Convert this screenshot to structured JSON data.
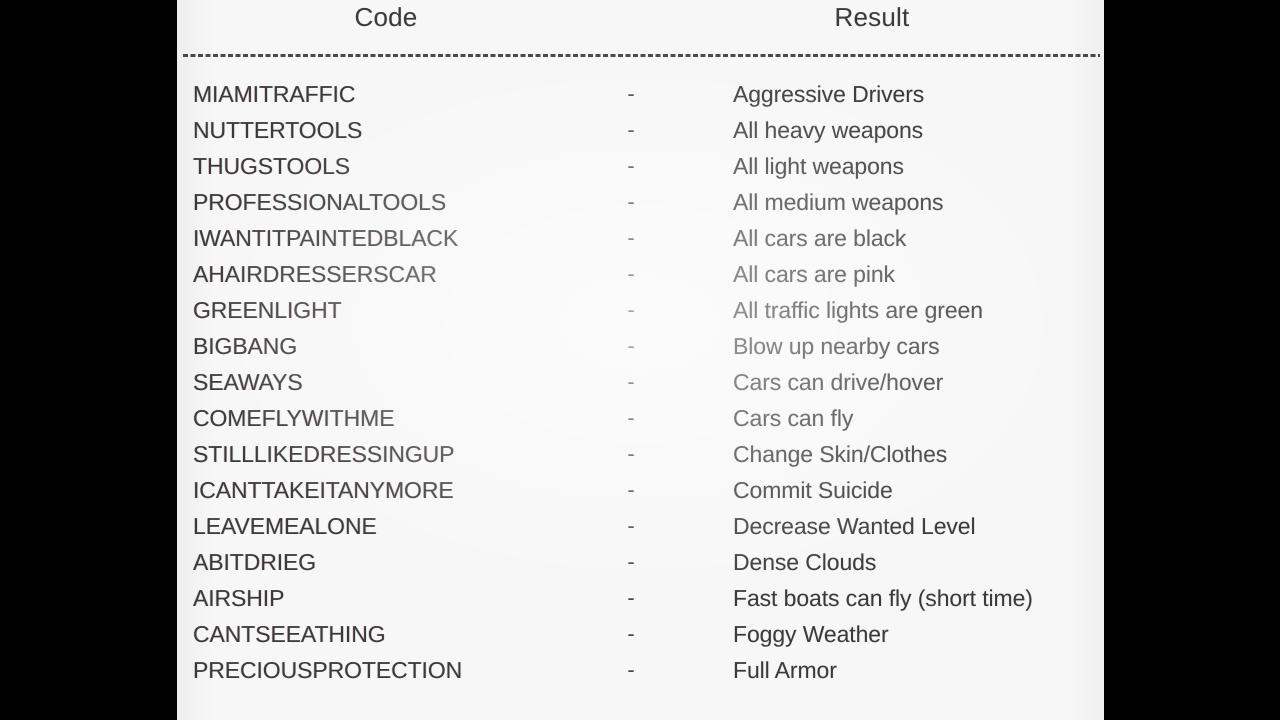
{
  "frame": {
    "letterbox_color": "#000000",
    "page_background": "#f7f7f7",
    "text_color": "#3a3a3a"
  },
  "table": {
    "headers": {
      "code": "Code",
      "result": "Result"
    },
    "separator": "-",
    "rows": [
      {
        "code": "MIAMITRAFFIC",
        "sep": "-",
        "result": "Aggressive Drivers"
      },
      {
        "code": "NUTTERTOOLS",
        "sep": "-",
        "result": "All heavy weapons"
      },
      {
        "code": "THUGSTOOLS",
        "sep": "-",
        "result": "All light weapons"
      },
      {
        "code": "PROFESSIONALTOOLS",
        "sep": "-",
        "result": "All medium weapons"
      },
      {
        "code": "IWANTITPAINTEDBLACK",
        "sep": "-",
        "result": "All cars are black"
      },
      {
        "code": "AHAIRDRESSERSCAR",
        "sep": "-",
        "result": "All cars are pink"
      },
      {
        "code": "GREENLIGHT",
        "sep": "-",
        "result": "All traffic lights are green"
      },
      {
        "code": "BIGBANG",
        "sep": "-",
        "result": "Blow up nearby cars"
      },
      {
        "code": "SEAWAYS",
        "sep": "-",
        "result": "Cars can drive/hover"
      },
      {
        "code": "COMEFLYWITHME",
        "sep": "-",
        "result": "Cars can fly"
      },
      {
        "code": "STILLLIKEDRESSINGUP",
        "sep": "-",
        "result": "Change Skin/Clothes"
      },
      {
        "code": "ICANTTAKEITANYMORE",
        "sep": "-",
        "result": "Commit Suicide"
      },
      {
        "code": "LEAVEMEALONE",
        "sep": "-",
        "result": "Decrease Wanted Level"
      },
      {
        "code": "ABITDRIEG",
        "sep": "-",
        "result": "Dense Clouds"
      },
      {
        "code": "AIRSHIP",
        "sep": "-",
        "result": "Fast boats can fly (short time)"
      },
      {
        "code": "CANTSEEATHING",
        "sep": "-",
        "result": "Foggy Weather"
      },
      {
        "code": "PRECIOUSPROTECTION",
        "sep": "-",
        "result": "Full Armor"
      }
    ]
  }
}
